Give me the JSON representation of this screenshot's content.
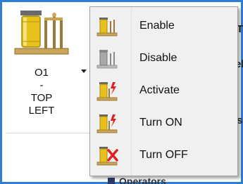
{
  "ribbon_button": {
    "caption_lines": [
      "O1",
      "-",
      "TOP",
      "LEFT"
    ]
  },
  "menu": {
    "items": [
      {
        "label": "Enable",
        "icon": "coil-enable-icon"
      },
      {
        "label": "Disable",
        "icon": "coil-disable-icon"
      },
      {
        "label": "Activate",
        "icon": "coil-activate-icon"
      },
      {
        "label": "Turn ON",
        "icon": "coil-turn-on-icon"
      },
      {
        "label": "Turn OFF",
        "icon": "coil-turn-off-icon"
      }
    ]
  },
  "background": {
    "partial_text_1": "T",
    "partial_text_2": "el",
    "partial_text_3": "s",
    "partial_text_4": "Operators"
  },
  "colors": {
    "frame_border": "#2e7fd3",
    "coil_yellow": "#e8c21c",
    "coil_red": "#e02020"
  }
}
